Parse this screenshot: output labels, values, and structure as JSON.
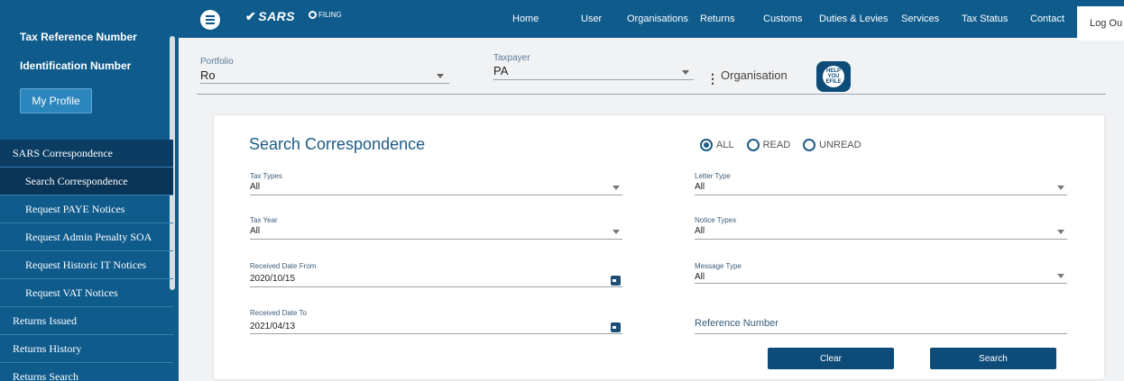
{
  "sidebar": {
    "tax_reference_label": "Tax Reference Number",
    "identification_label": "Identification Number",
    "profile_button": "My Profile",
    "menu": [
      {
        "label": "SARS Correspondence",
        "kind": "section"
      },
      {
        "label": "Search Correspondence",
        "kind": "active"
      },
      {
        "label": "Request PAYE Notices",
        "kind": "sub"
      },
      {
        "label": "Request Admin Penalty SOA",
        "kind": "sub"
      },
      {
        "label": "Request Historic IT Notices",
        "kind": "sub"
      },
      {
        "label": "Request VAT Notices",
        "kind": "sub"
      },
      {
        "label": "Returns Issued",
        "kind": "top"
      },
      {
        "label": "Returns History",
        "kind": "top"
      },
      {
        "label": "Returns Search",
        "kind": "top"
      }
    ]
  },
  "header": {
    "logo_text": "SARS",
    "efiling_text": "FILING",
    "nav": [
      "Home",
      "User",
      "Organisations",
      "Returns",
      "Customs",
      "Duties & Levies",
      "Services",
      "Tax Status",
      "Contact"
    ],
    "logout": "Log Ou"
  },
  "portfolio_bar": {
    "portfolio_label": "Portfolio",
    "portfolio_value": "Ro",
    "taxpayer_label": "Taxpayer",
    "taxpayer_value": "PA",
    "organisation_label": "Organisation",
    "help_icon_text": "HELP YOU EFILE"
  },
  "form": {
    "title": "Search Correspondence",
    "radios": [
      {
        "label": "ALL",
        "selected": true
      },
      {
        "label": "READ",
        "selected": false
      },
      {
        "label": "UNREAD",
        "selected": false
      }
    ],
    "tax_types": {
      "label": "Tax Types",
      "value": "All"
    },
    "letter_type": {
      "label": "Letter Type",
      "value": "All"
    },
    "tax_year": {
      "label": "Tax Year",
      "value": "All"
    },
    "notice_types": {
      "label": "Notice Types",
      "value": "All"
    },
    "date_from": {
      "label": "Received Date From",
      "value": "2020/10/15"
    },
    "message_type": {
      "label": "Message Type",
      "value": "All"
    },
    "date_to": {
      "label": "Received Date To",
      "value": "2021/04/13"
    },
    "reference_number": {
      "placeholder": "Reference Number"
    },
    "clear_button": "Clear",
    "search_button": "Search"
  }
}
